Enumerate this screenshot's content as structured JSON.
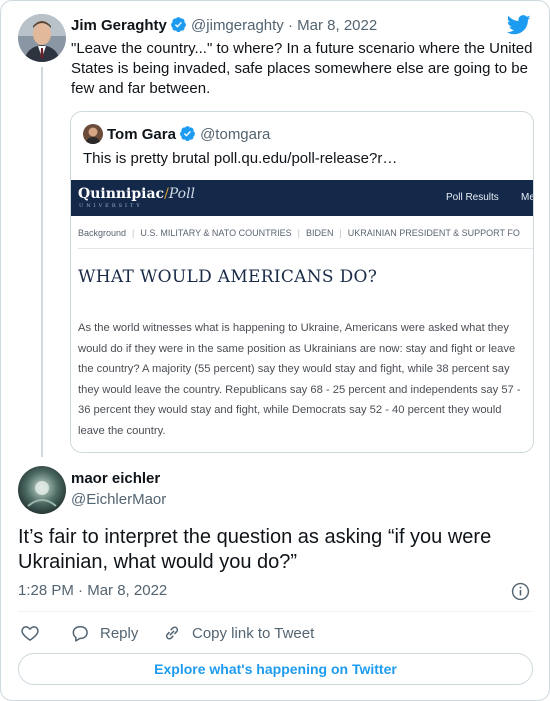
{
  "parent": {
    "name": "Jim Geraghty",
    "handle": "@jimgeraghty",
    "date": "Mar 8, 2022",
    "text": "\"Leave the country...\" to where? In a future scenario where the United States  is being invaded, safe places somewhere else are going to be few and far between."
  },
  "quoted": {
    "name": "Tom Gara",
    "handle": "@tomgara",
    "text": "This is pretty brutal poll.qu.edu/poll-release?r…",
    "screenshot": {
      "logo_left": "Quinnipiac",
      "logo_slash": "/",
      "logo_right": "Poll",
      "logo_sub": "UNIVERSITY",
      "nav": [
        "Poll Results",
        "Me"
      ],
      "breadcrumbs": [
        "Background",
        "U.S. MILITARY & NATO COUNTRIES",
        "BIDEN",
        "UKRAINIAN PRESIDENT & SUPPORT FO"
      ],
      "headline": "WHAT WOULD AMERICANS DO?",
      "body": "As the world witnesses what is happening to Ukraine, Americans were asked what they would do if they were in the same position as Ukrainians are now: stay and fight or leave the country? A majority (55 percent) say they would stay and fight, while 38 percent say they would leave the country. Republicans say 68 - 25 percent and independents say 57 - 36 percent they would stay and fight, while Democrats say 52 - 40 percent they would leave the country."
    }
  },
  "reply": {
    "name": "maor eichler",
    "handle": "@EichlerMaor",
    "text": "It’s fair to interpret the question as asking “if you were Ukrainian, what would you do?”",
    "time": "1:28 PM",
    "date": "Mar 8, 2022"
  },
  "actions": {
    "like_icon": "heart-icon",
    "reply_label": "Reply",
    "copy_label": "Copy link to Tweet"
  },
  "explore_label": "Explore what's happening on Twitter",
  "colors": {
    "twitter_blue": "#1d9bf0",
    "text": "#0f1419",
    "muted": "#536471",
    "border": "#cfd9de",
    "quinnipiac_navy": "#14294a"
  }
}
